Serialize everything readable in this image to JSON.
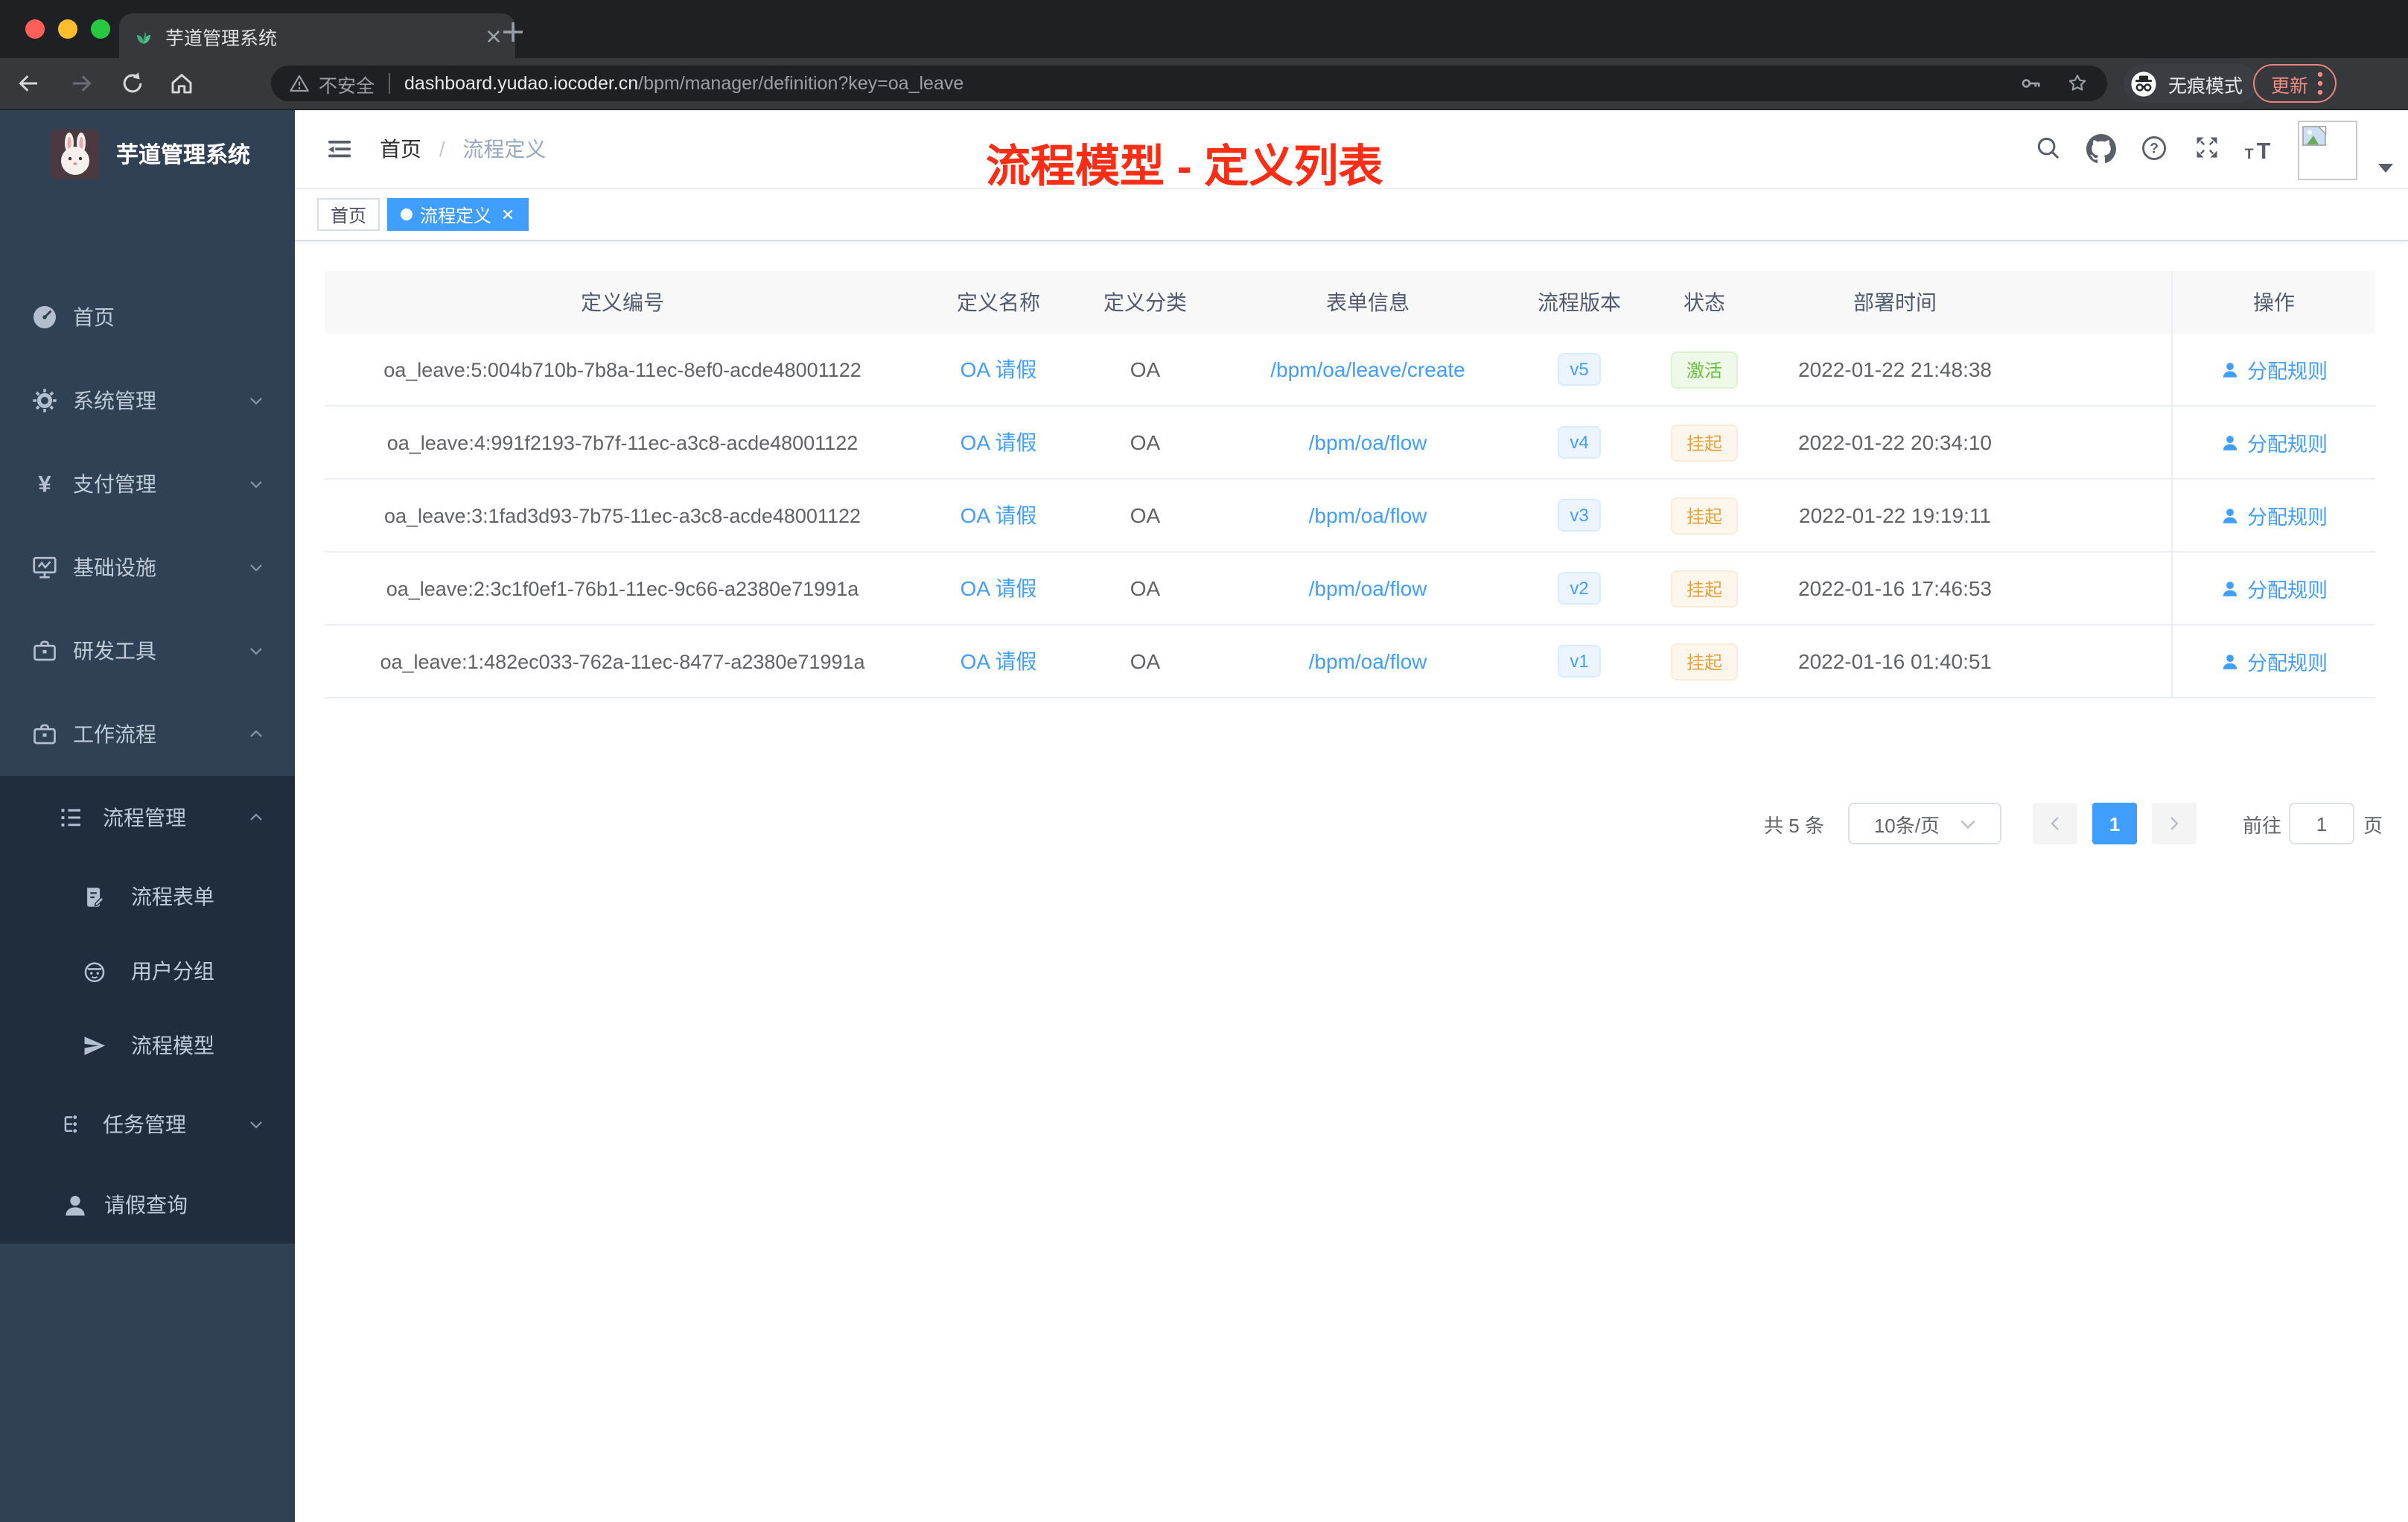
{
  "browser": {
    "tab_title": "芋道管理系统",
    "security_label": "不安全",
    "url_domain": "dashboard.yudao.iocoder.cn",
    "url_path": "/bpm/manager/definition?key=oa_leave",
    "incognito_label": "无痕模式",
    "update_label": "更新"
  },
  "sidebar": {
    "app_title": "芋道管理系统",
    "menu": [
      {
        "label": "首页",
        "icon": "dashboard-icon"
      },
      {
        "label": "系统管理",
        "icon": "gear-icon"
      },
      {
        "label": "支付管理",
        "icon": "yen-icon"
      },
      {
        "label": "基础设施",
        "icon": "monitor-icon"
      },
      {
        "label": "研发工具",
        "icon": "briefcase-icon"
      },
      {
        "label": "工作流程",
        "icon": "briefcase-icon"
      }
    ],
    "submenu": {
      "group_label": "流程管理",
      "children": [
        {
          "label": "流程表单",
          "icon": "form-icon"
        },
        {
          "label": "用户分组",
          "icon": "user-group-icon"
        },
        {
          "label": "流程模型",
          "icon": "paper-plane-icon"
        }
      ],
      "tasks_label": "任务管理",
      "leave_label": "请假查询"
    }
  },
  "header": {
    "breadcrumb_home": "首页",
    "breadcrumb_sep": "/",
    "breadcrumb_current": "流程定义",
    "annotation": "流程模型 - 定义列表"
  },
  "tags": {
    "home": "首页",
    "active": "流程定义"
  },
  "table": {
    "headers": [
      "定义编号",
      "定义名称",
      "定义分类",
      "表单信息",
      "流程版本",
      "状态",
      "部署时间",
      "操作"
    ],
    "rows": [
      {
        "id": "oa_leave:5:004b710b-7b8a-11ec-8ef0-acde48001122",
        "name": "OA 请假",
        "category": "OA",
        "form": "/bpm/oa/leave/create",
        "version": "v5",
        "status": "激活",
        "status_color": "green",
        "deploy_time": "2022-01-22 21:48:38",
        "action": "分配规则"
      },
      {
        "id": "oa_leave:4:991f2193-7b7f-11ec-a3c8-acde48001122",
        "name": "OA 请假",
        "category": "OA",
        "form": "/bpm/oa/flow",
        "version": "v4",
        "status": "挂起",
        "status_color": "orange",
        "deploy_time": "2022-01-22 20:34:10",
        "action": "分配规则"
      },
      {
        "id": "oa_leave:3:1fad3d93-7b75-11ec-a3c8-acde48001122",
        "name": "OA 请假",
        "category": "OA",
        "form": "/bpm/oa/flow",
        "version": "v3",
        "status": "挂起",
        "status_color": "orange",
        "deploy_time": "2022-01-22 19:19:11",
        "action": "分配规则"
      },
      {
        "id": "oa_leave:2:3c1f0ef1-76b1-11ec-9c66-a2380e71991a",
        "name": "OA 请假",
        "category": "OA",
        "form": "/bpm/oa/flow",
        "version": "v2",
        "status": "挂起",
        "status_color": "orange",
        "deploy_time": "2022-01-16 17:46:53",
        "action": "分配规则"
      },
      {
        "id": "oa_leave:1:482ec033-762a-11ec-8477-a2380e71991a",
        "name": "OA 请假",
        "category": "OA",
        "form": "/bpm/oa/flow",
        "version": "v1",
        "status": "挂起",
        "status_color": "orange",
        "deploy_time": "2022-01-16 01:40:51",
        "action": "分配规则"
      }
    ]
  },
  "pagination": {
    "total": "共 5 条",
    "page_size": "10条/页",
    "page": "1",
    "goto_label": "前往",
    "goto_value": "1",
    "page_unit": "页"
  },
  "colors": {
    "accent": "#409eff",
    "status_active": "#67c23a",
    "status_suspended": "#e6a23c",
    "annotation_red": "#fb2d15",
    "sidebar_bg": "#304156",
    "submenu_bg": "#1f2d3d"
  }
}
